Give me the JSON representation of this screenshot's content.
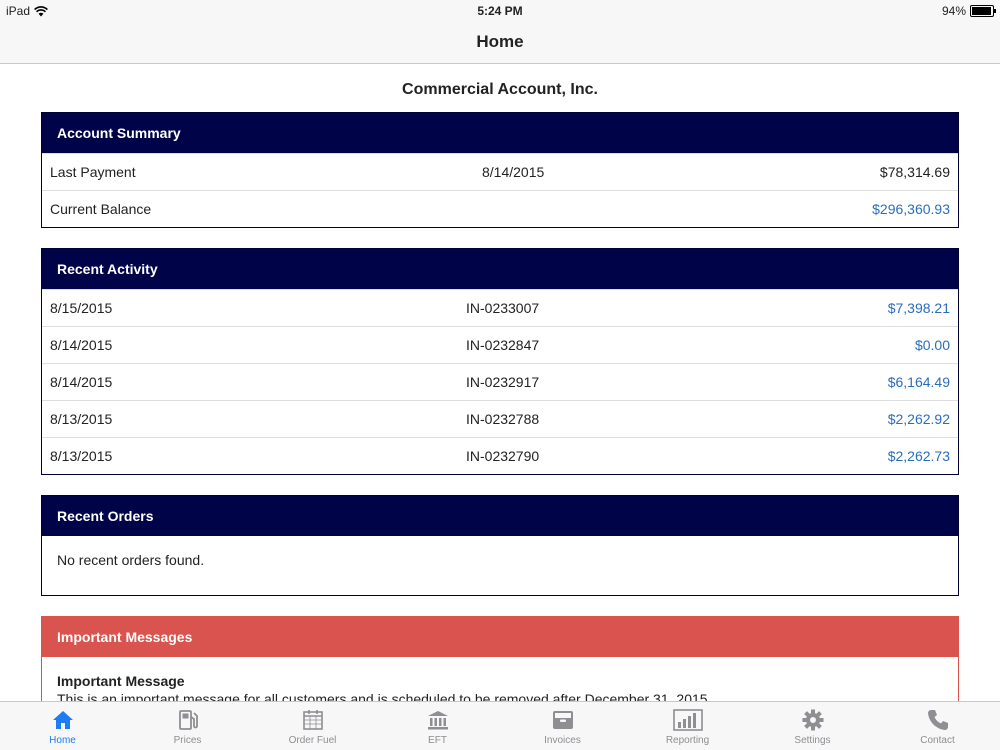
{
  "status_bar": {
    "device": "iPad",
    "time": "5:24 PM",
    "battery": "94%",
    "battery_level": 0.94
  },
  "nav": {
    "title": "Home"
  },
  "company_name": "Commercial Account, Inc.",
  "account_summary": {
    "title": "Account Summary",
    "rows": [
      {
        "label": "Last Payment",
        "date": "8/14/2015",
        "amount": "$78,314.69"
      },
      {
        "label": "Current Balance",
        "date": "",
        "amount": "$296,360.93"
      }
    ]
  },
  "recent_activity": {
    "title": "Recent Activity",
    "rows": [
      {
        "date": "8/15/2015",
        "invoice": "IN-0233007",
        "amount": "$7,398.21"
      },
      {
        "date": "8/14/2015",
        "invoice": "IN-0232847",
        "amount": "$0.00"
      },
      {
        "date": "8/14/2015",
        "invoice": "IN-0232917",
        "amount": "$6,164.49"
      },
      {
        "date": "8/13/2015",
        "invoice": "IN-0232788",
        "amount": "$2,262.92"
      },
      {
        "date": "8/13/2015",
        "invoice": "IN-0232790",
        "amount": "$2,262.73"
      }
    ]
  },
  "recent_orders": {
    "title": "Recent Orders",
    "empty_text": "No recent orders found."
  },
  "important_messages": {
    "title": "Important Messages",
    "message_title": "Important Message",
    "message_text": "This is an important message for all customers and is scheduled to be removed after December 31, 2015."
  },
  "colors": {
    "panel_header": "#000347",
    "alert_header": "#d9534f",
    "link": "#2a6ebb",
    "tab_active": "#1e7cf2",
    "tab_inactive": "#8e8e93"
  },
  "tabs": [
    {
      "label": "Home",
      "icon": "home-icon",
      "active": true
    },
    {
      "label": "Prices",
      "icon": "fuel-pump-icon",
      "active": false
    },
    {
      "label": "Order Fuel",
      "icon": "calendar-icon",
      "active": false
    },
    {
      "label": "EFT",
      "icon": "bank-icon",
      "active": false
    },
    {
      "label": "Invoices",
      "icon": "file-box-icon",
      "active": false
    },
    {
      "label": "Reporting",
      "icon": "bar-chart-icon",
      "active": false
    },
    {
      "label": "Settings",
      "icon": "gear-icon",
      "active": false
    },
    {
      "label": "Contact",
      "icon": "phone-icon",
      "active": false
    }
  ]
}
